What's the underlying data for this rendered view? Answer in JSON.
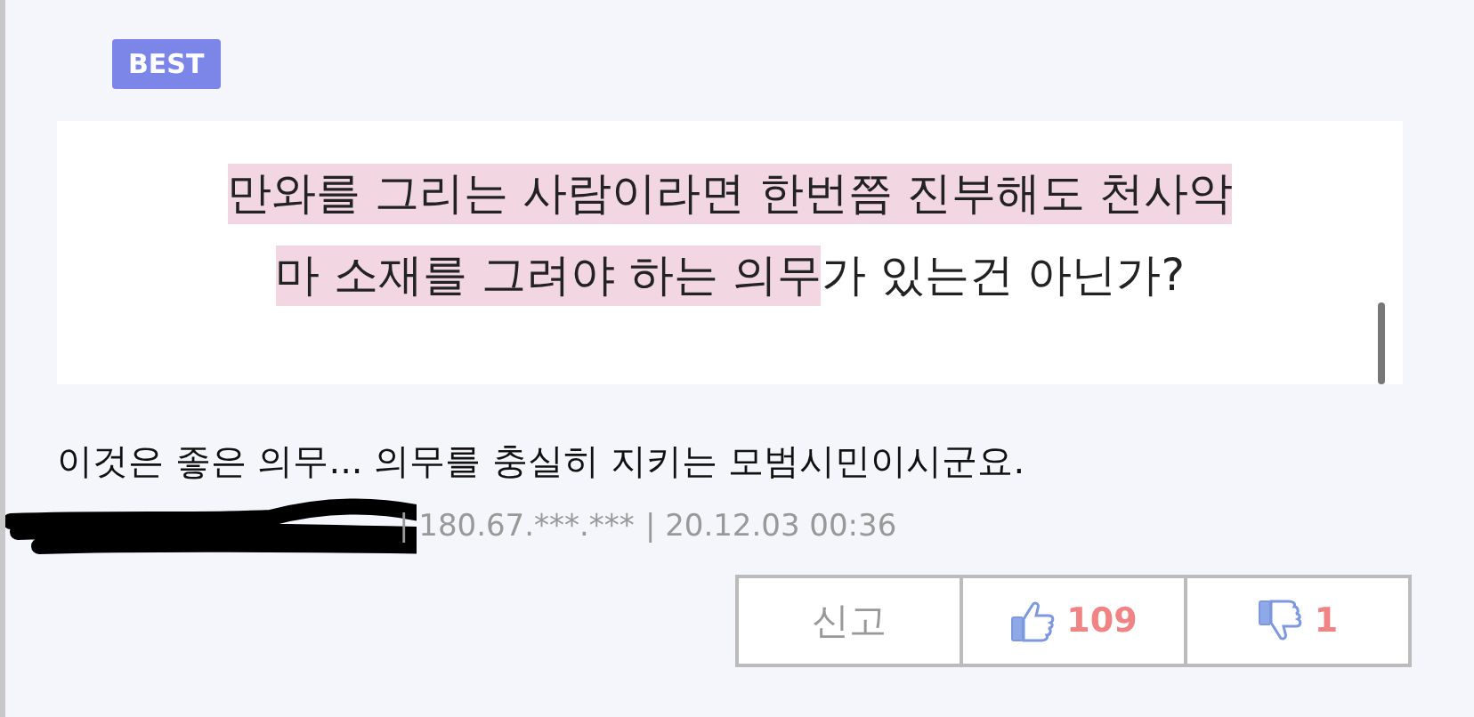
{
  "badge": "BEST",
  "attachment": {
    "lines": [
      [
        {
          "text": "만와를 그리는 사람이라면 한번쯤 진부해도 천사악",
          "highlighted": true
        }
      ],
      [
        {
          "text": "마 소재를 그려야 하는 의무",
          "highlighted": true
        },
        {
          "text": "가 있는건 아닌가?",
          "highlighted": false
        }
      ]
    ]
  },
  "comment": "이것은 좋은 의무... 의무를 충실히 지키는 모범시민이시군요.",
  "meta": {
    "ip": "| 180.67.***.***",
    "date": "| 20.12.03 00:36"
  },
  "actions": {
    "report": "신고",
    "likes": "109",
    "dislikes": "1"
  }
}
